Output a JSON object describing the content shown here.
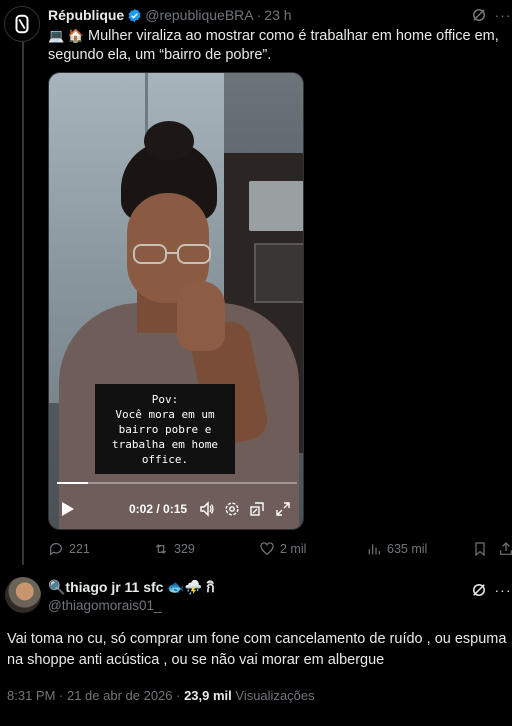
{
  "tweet1": {
    "name": "République",
    "handle": "@republiqueBRA",
    "time": "23 h",
    "text_emoji": "💻 🏠",
    "text": "Mulher viraliza ao mostrar como é trabalhar em home office em, segundo ela, um “bairro de pobre”.",
    "video": {
      "caption": "Pov:\nVocê mora em um\nbairro pobre e\ntrabalha em home\noffice.",
      "time": "0:02 / 0:15",
      "progress": 0.13
    },
    "actions": {
      "replies": "221",
      "retweets": "329",
      "likes": "2 mil",
      "views": "635 mil"
    }
  },
  "reply": {
    "name": "🔍thiago jr 11 sfc 🐟⛈️ กิ",
    "handle": "@thiagomorais01_",
    "text": "Vai toma no cu, só comprar um fone com cancelamento de ruído , ou espuma na shoppe anti acústica , ou se não vai morar em albergue",
    "time_date": "8:31 PM · 21 de abr de 2026 · ",
    "views_count": "23,9 mil",
    "views_label": " Visualizações"
  },
  "colors": {
    "background": "#000000",
    "text": "#e7e9ea",
    "muted": "#71767b",
    "verified": "#1d9bf0"
  }
}
